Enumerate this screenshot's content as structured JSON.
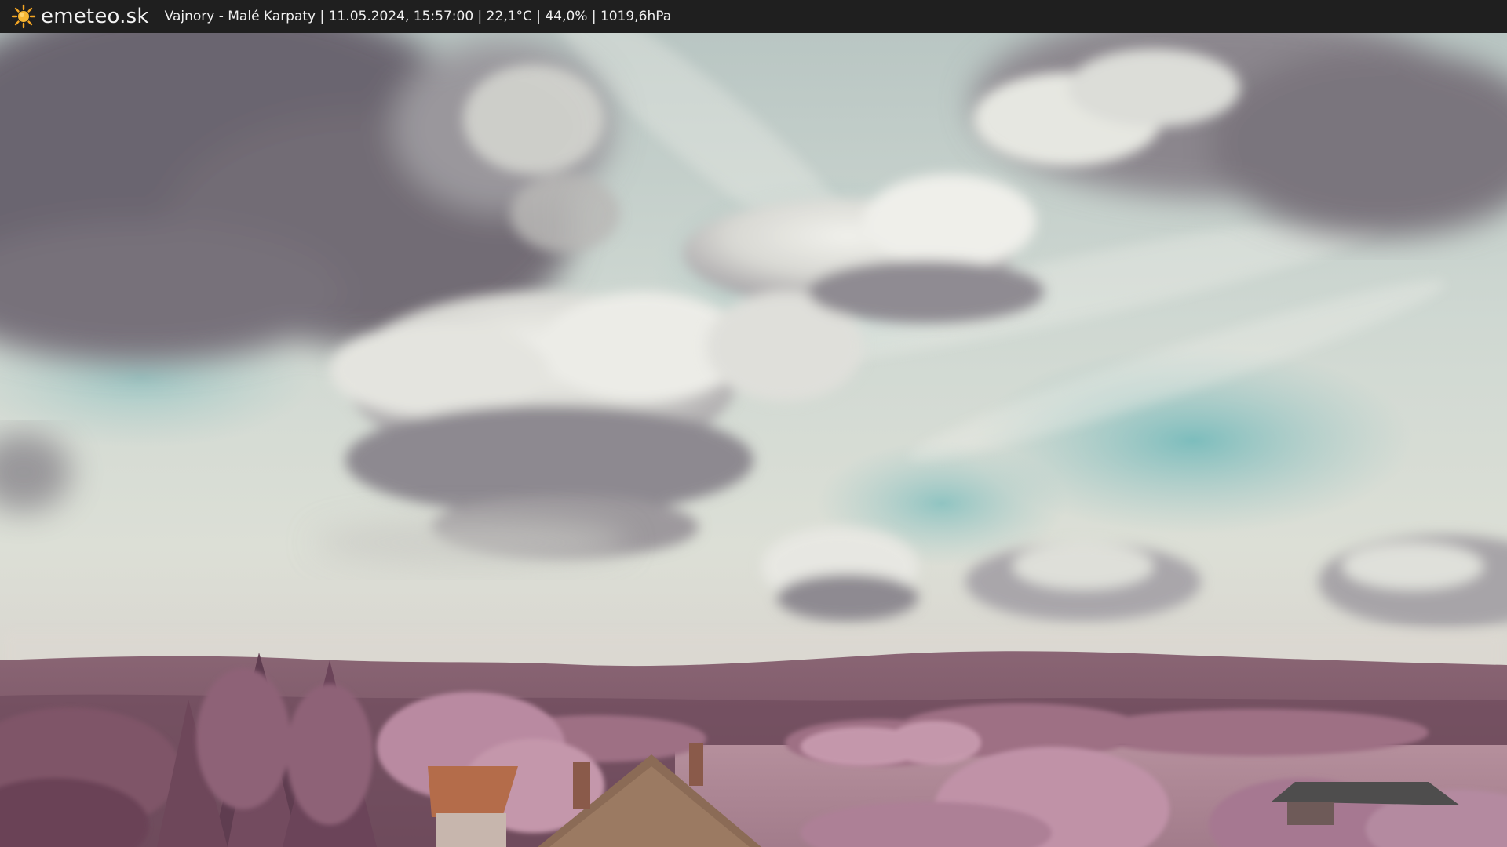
{
  "header": {
    "brand": "emeteo.sk",
    "logo_icon": "sun-icon",
    "info_line": "Vajnory - Malé Karpaty | 11.05.2024, 15:57:00 | 22,1°C | 44,0% | 1019,6hPa"
  },
  "colors": {
    "bar_background": "#1f1f1f",
    "sun": "#f5a623",
    "sky_light": "#dfe3da",
    "sky_teal": "#8fc0bf",
    "cloud_dark": "#6e6770",
    "hills": "#7b5566",
    "foliage": "#b9879b"
  }
}
